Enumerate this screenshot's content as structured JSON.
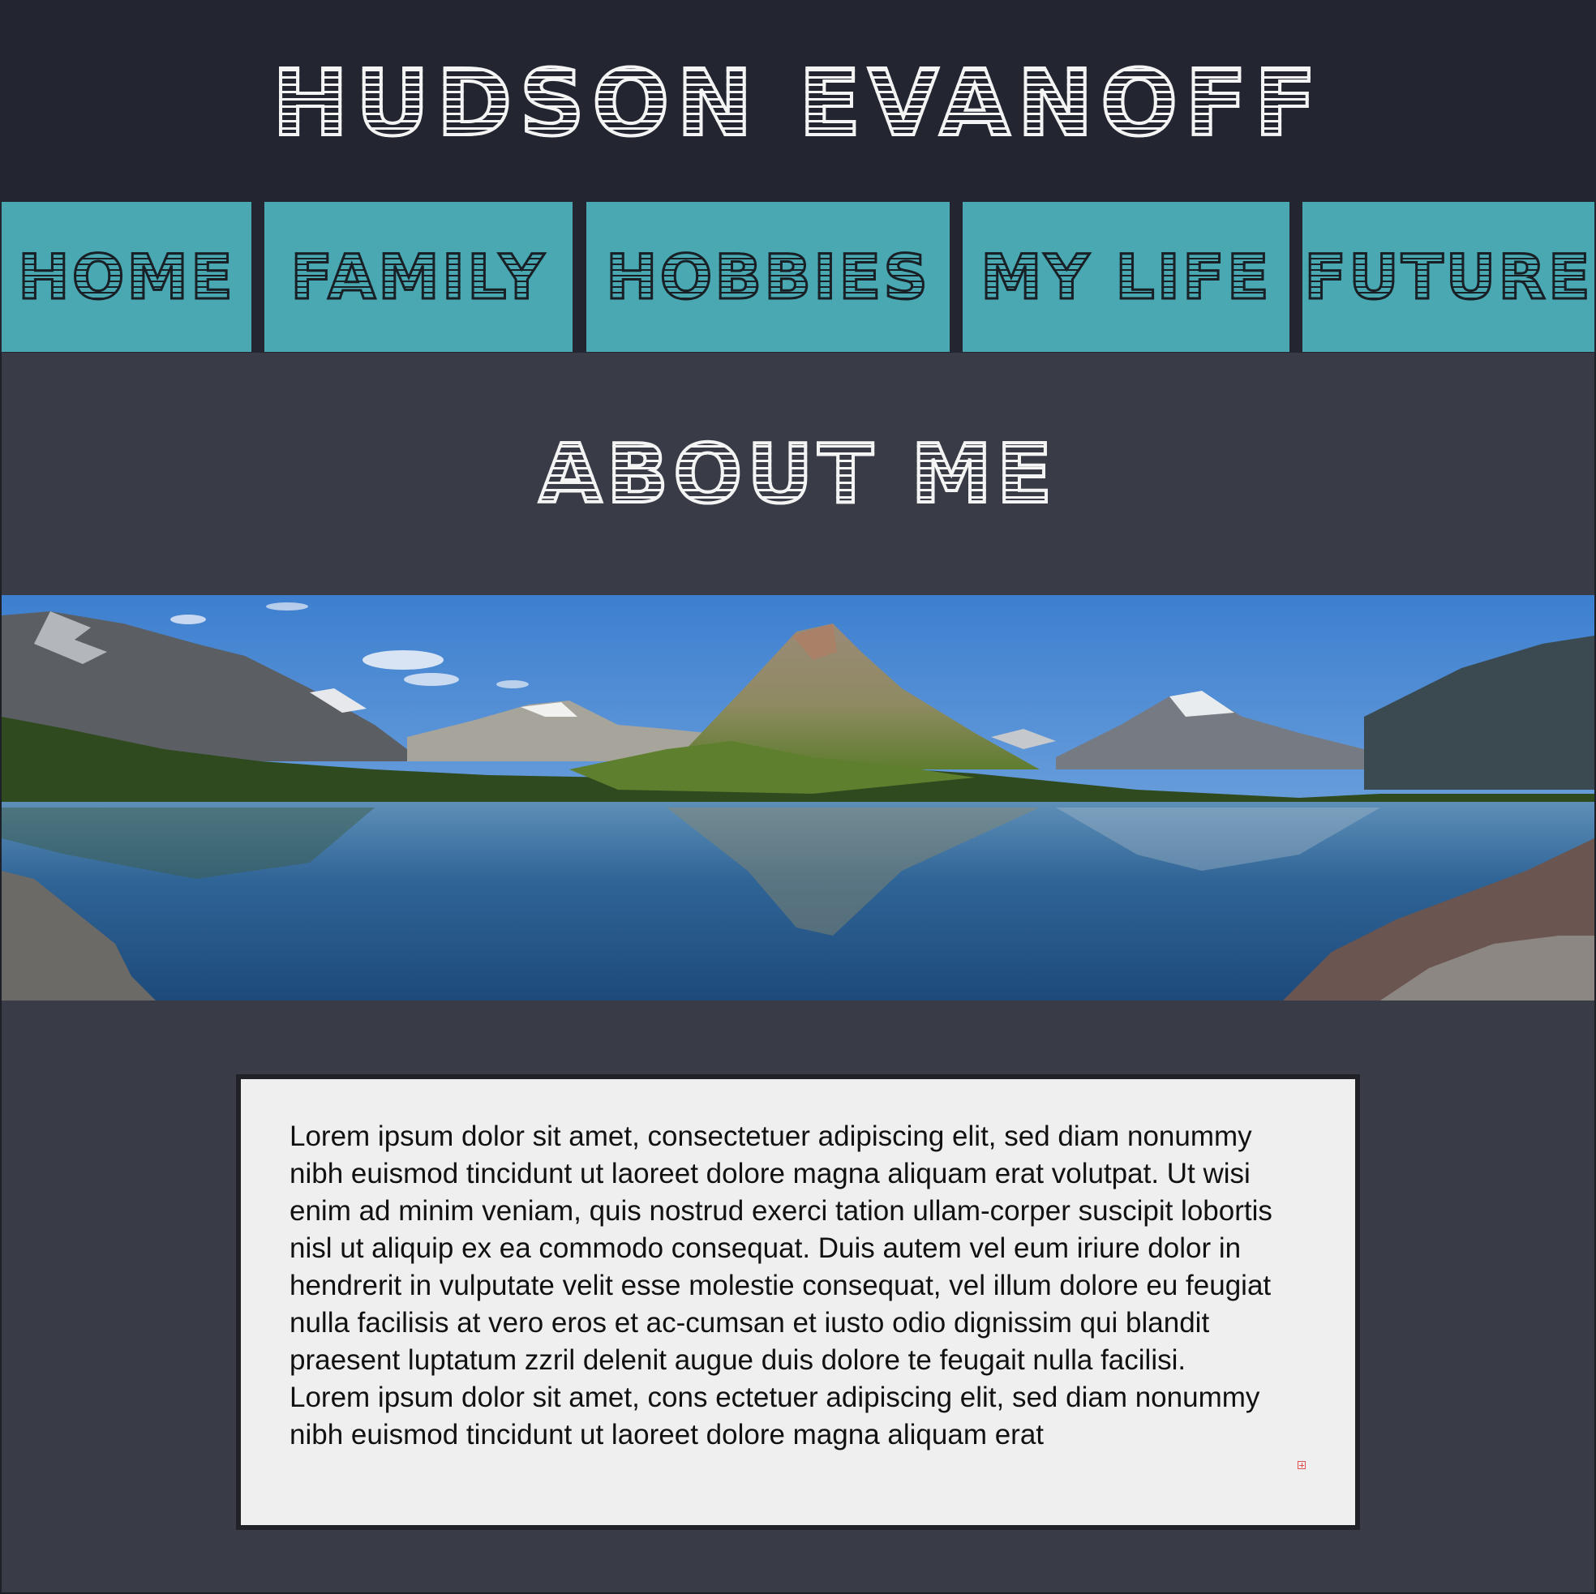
{
  "header": {
    "title": "HUDSON EVANOFF"
  },
  "nav": {
    "items": [
      {
        "label": "HOME"
      },
      {
        "label": "FAMILY"
      },
      {
        "label": "HOBBIES"
      },
      {
        "label": "MY LIFE"
      },
      {
        "label": "FUTURE"
      }
    ]
  },
  "main": {
    "heading": "ABOUT ME",
    "banner_image": "mountain-lake-panorama",
    "paragraphs": [
      "Lorem ipsum dolor sit amet, consectetuer adipiscing elit, sed diam nonummy nibh euismod tincidunt ut laoreet dolore magna aliquam erat volutpat. Ut wisi enim ad minim veniam, quis nostrud exerci tation ullam-corper suscipit lobortis nisl ut aliquip ex ea commodo consequat. Duis autem vel eum iriure dolor in hendrerit in vulputate velit esse molestie consequat, vel illum dolore eu feugiat nulla facilisis at vero eros et ac-cumsan et iusto odio dignissim qui blandit praesent luptatum zzril delenit augue duis dolore te feugait nulla facilisi.",
      "Lorem ipsum dolor sit amet, cons ectetuer adipiscing elit, sed diam nonummy nibh euismod tincidunt ut laoreet dolore magna aliquam erat"
    ]
  },
  "colors": {
    "header_bg": "#232630",
    "page_bg": "#393c46",
    "nav_accent": "#49a8b2",
    "card_bg": "#efefef"
  }
}
